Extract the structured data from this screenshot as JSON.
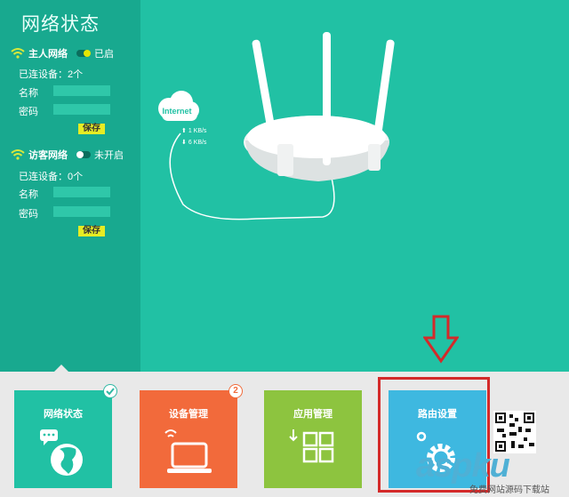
{
  "panel_title": "网络状态",
  "host_network": {
    "title": "主人网络",
    "state": "已启",
    "connected": "已连设备：2个",
    "name_label": "名称",
    "password_label": "密码",
    "save_label": "保存"
  },
  "guest_network": {
    "title": "访客网络",
    "state": "未开启",
    "connected": "已连设备：0个",
    "name_label": "名称",
    "password_label": "密码",
    "save_label": "保存"
  },
  "illustration": {
    "cloud_label": "Internet",
    "upload": "1 KB/s",
    "download": "6 KB/s"
  },
  "tiles": [
    {
      "label": "网络状态",
      "color": "#21c1a4"
    },
    {
      "label": "设备管理",
      "color": "#f26a3b",
      "badge": "2"
    },
    {
      "label": "应用管理",
      "color": "#8dc43f"
    },
    {
      "label": "路由设置",
      "color": "#3eb8e0"
    }
  ],
  "watermark": {
    "text": "aspku",
    "sub": "免费网站源码下载站"
  },
  "colors": {
    "sidebar": "#18a98f",
    "main": "#21c1a4",
    "highlight": "#d42a2a"
  }
}
